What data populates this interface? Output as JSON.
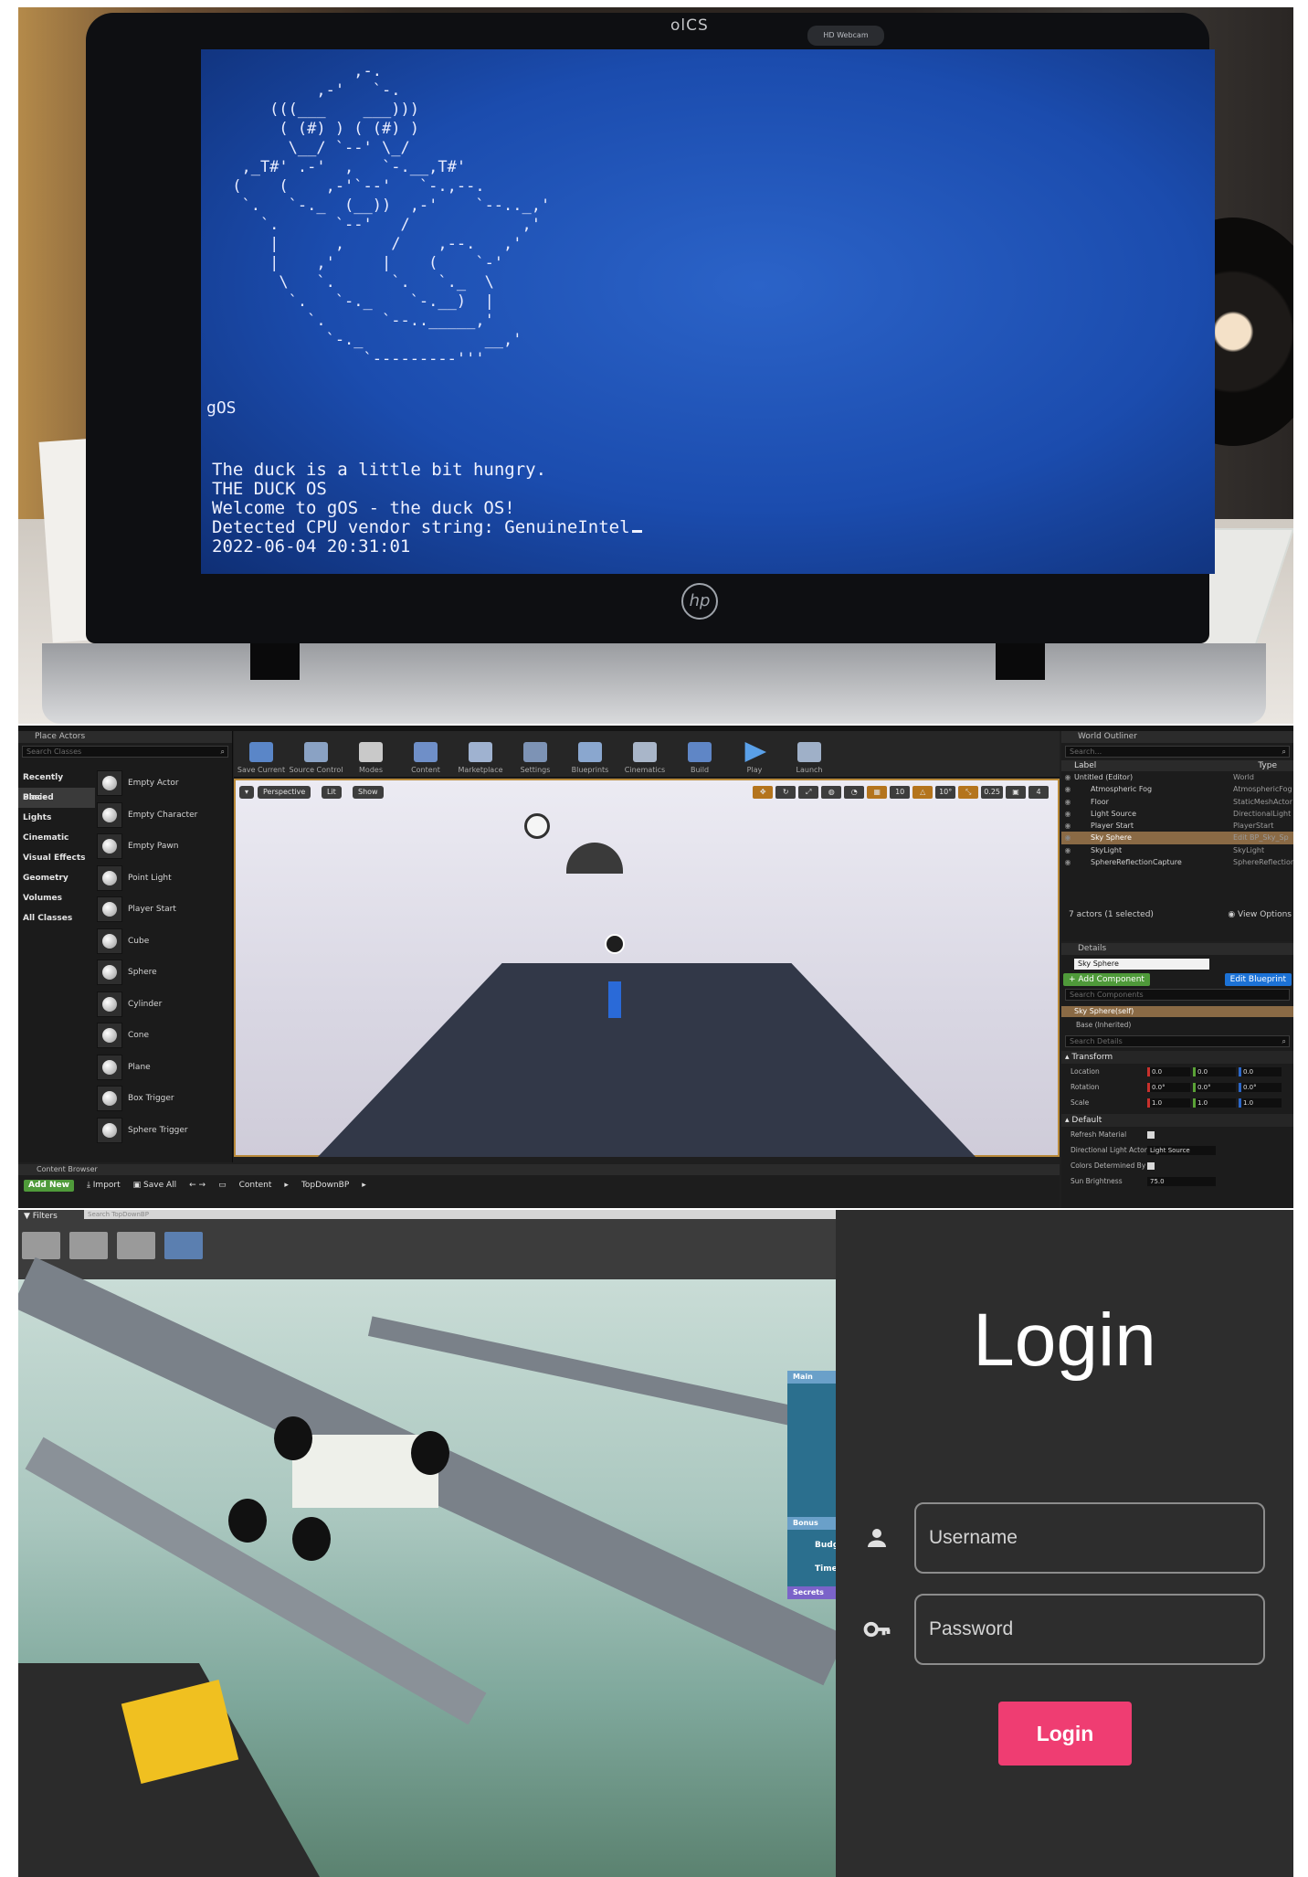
{
  "os_screen": {
    "brand_text": "olCS",
    "webcam_badge": "HD Webcam",
    "os_label": "gOS",
    "console_lines": [
      "The duck is a little bit hungry.",
      "THE DUCK OS",
      "Welcome to gOS - the duck OS!",
      "Detected CPU vendor string: GenuineIntel"
    ],
    "timestamp": "2022-06-04 20:31:01",
    "laptop_logo": "hp",
    "colors": {
      "screen": "#1f52b8",
      "text": "#eef1ff"
    }
  },
  "editor": {
    "place_actors": {
      "tab_label": "Place Actors",
      "search_placeholder": "Search Classes",
      "categories": [
        "Recently Placed",
        "Basic",
        "Lights",
        "Cinematic",
        "Visual Effects",
        "Geometry",
        "Volumes",
        "All Classes"
      ],
      "active_category": "Basic",
      "items": [
        "Empty Actor",
        "Empty Character",
        "Empty Pawn",
        "Point Light",
        "Player Start",
        "Cube",
        "Sphere",
        "Cylinder",
        "Cone",
        "Plane",
        "Box Trigger",
        "Sphere Trigger"
      ]
    },
    "toolbar": [
      "Save Current",
      "Source Control",
      "Modes",
      "Content",
      "Marketplace",
      "Settings",
      "Blueprints",
      "Cinematics",
      "Build",
      "Play",
      "Launch"
    ],
    "viewport": {
      "buttons": [
        "Perspective",
        "Lit",
        "Show"
      ],
      "snap_values": [
        "10",
        "10°",
        "0.25",
        "4"
      ]
    },
    "outliner": {
      "tab_label": "World Outliner",
      "search_placeholder": "Search...",
      "col_label": "Label",
      "col_type": "Type",
      "rows": [
        {
          "label": "Untitled (Editor)",
          "type": "World"
        },
        {
          "label": "Atmospheric Fog",
          "type": "AtmosphericFog"
        },
        {
          "label": "Floor",
          "type": "StaticMeshActor"
        },
        {
          "label": "Light Source",
          "type": "DirectionalLight"
        },
        {
          "label": "Player Start",
          "type": "PlayerStart"
        },
        {
          "label": "Sky Sphere",
          "type": "Edit BP_Sky_Sp"
        },
        {
          "label": "SkyLight",
          "type": "SkyLight"
        },
        {
          "label": "SphereReflectionCapture",
          "type": "SphereReflection"
        }
      ],
      "selected_index": 5,
      "actor_count": "7 actors (1 selected)",
      "view_options": "View Options"
    },
    "details": {
      "tab_label": "Details",
      "actor_name": "Sky Sphere",
      "add_component": "+ Add Component",
      "edit_blueprint": "Edit Blueprint",
      "search_components_placeholder": "Search Components",
      "component_self": "Sky Sphere(self)",
      "component_base": "Base (Inherited)",
      "search_details_placeholder": "Search Details",
      "transform_label": "Transform",
      "props": [
        {
          "name": "Location",
          "values": [
            "0.0",
            "0.0",
            "0.0"
          ]
        },
        {
          "name": "Rotation",
          "values": [
            "0.0°",
            "0.0°",
            "0.0°"
          ]
        },
        {
          "name": "Scale",
          "values": [
            "1.0",
            "1.0",
            "1.0"
          ]
        }
      ],
      "default_label": "Default",
      "refresh_material": "Refresh Material",
      "directional_light_actor": "Directional Light Actor",
      "directional_light_value": "Light Source",
      "colors_determined_by": "Colors Determined By",
      "sun_brightness_label": "Sun Brightness",
      "sun_brightness": "75.0"
    },
    "content_browser": {
      "tab_label": "Content Browser",
      "add_new": "Add New",
      "import": "Import",
      "save_all": "Save All",
      "path": [
        "Content",
        "TopDownBP"
      ],
      "filters": "Filters",
      "search_placeholder": "Search TopDownBP"
    }
  },
  "game": {
    "hud": {
      "main": "Main",
      "bonus": "Bonus",
      "budget": "Budg",
      "time": "Time",
      "secrets": "Secrets"
    }
  },
  "login": {
    "title": "Login",
    "username_placeholder": "Username",
    "password_placeholder": "Password",
    "button_label": "Login",
    "accent_color": "#ef3d72"
  }
}
